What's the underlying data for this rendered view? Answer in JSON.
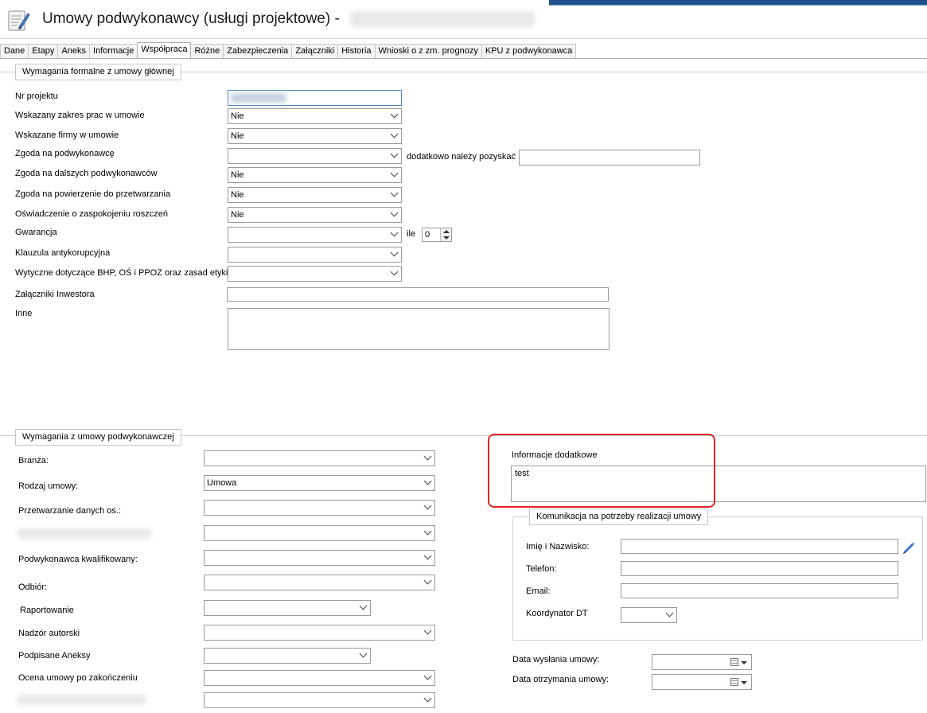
{
  "window": {
    "title": "Umowy podwykonawcy (usługi projektowe) -",
    "icon": "document-pencil-icon"
  },
  "tabs": [
    "Dane",
    "Etapy",
    "Aneks",
    "Informacje",
    "Współpraca",
    "Różne",
    "Zabezpieczenia",
    "Załączniki",
    "Historia",
    "Wnioski o z zm. prognozy",
    "KPU z  podwykonawca"
  ],
  "active_tab": "Współpraca",
  "formal": {
    "group_title": "Wymagania formalne z umowy głównej",
    "nr_projektu_label": "Nr projektu",
    "zakres_label": "Wskazany zakres prac w umowie",
    "zakres_value": "Nie",
    "firmy_label": "Wskazane firmy w umowie",
    "firmy_value": "Nie",
    "zgoda_label": "Zgoda na podwykonawcę",
    "zgoda_value": "",
    "dodatkowo_label": "dodatkowo należy pozyskać",
    "dalszych_label": "Zgoda na dalszych podwykonawców",
    "dalszych_value": "Nie",
    "powierzenie_label": "Zgoda na powierzenie do przetwarzania",
    "powierzenie_value": "Nie",
    "oswiadczenie_label": "Oświadczenie o zaspokojeniu roszczeń",
    "oswiadczenie_value": "Nie",
    "gwarancja_label": "Gwarancja",
    "gwarancja_value": "",
    "ile_label": "ile",
    "ile_value": "0",
    "klauzula_label": "Klauzula antykorupcyjna",
    "klauzula_value": "",
    "wytyczne_label": "Wytyczne dotyczące BHP, OŚ i PPOZ oraz zasad etyki",
    "wytyczne_value": "",
    "zalaczniki_label": "Załączniki Inwestora",
    "inne_label": "Inne"
  },
  "sub": {
    "group_title": "Wymagania z umowy podwykonawczej",
    "branza_label": "Branża:",
    "rodzaj_label": "Rodzaj umowy:",
    "rodzaj_value": "Umowa",
    "przetwarzanie_label": "Przetwarzanie danych os.:",
    "kwalifikowany_label": "Podwykonawca kwalifikowany:",
    "odbior_label": "Odbiór:",
    "raportowanie_label": "Raportowanie",
    "nadzor_label": "Nadzór autorski",
    "aneksy_label": "Podpisane Aneksy",
    "ocena_label": "Ocena umowy po zakończeniu"
  },
  "info": {
    "label": "Informacje dodatkowe",
    "value": "test"
  },
  "komunikacja": {
    "group_title": "Komunikacja na potrzeby realizacji umowy",
    "imie_label": "Imię i Nazwisko:",
    "telefon_label": "Telefon:",
    "email_label": "Email:",
    "koordynator_label": "Koordynator DT"
  },
  "dates": {
    "wyslania_label": "Data wysłania umowy:",
    "otrzymania_label": "Data otrzymania umowy:"
  },
  "colors": {
    "highlight_border": "#e02424",
    "focus_border": "#4a84c8",
    "title_strip": "#1f4e8c"
  }
}
